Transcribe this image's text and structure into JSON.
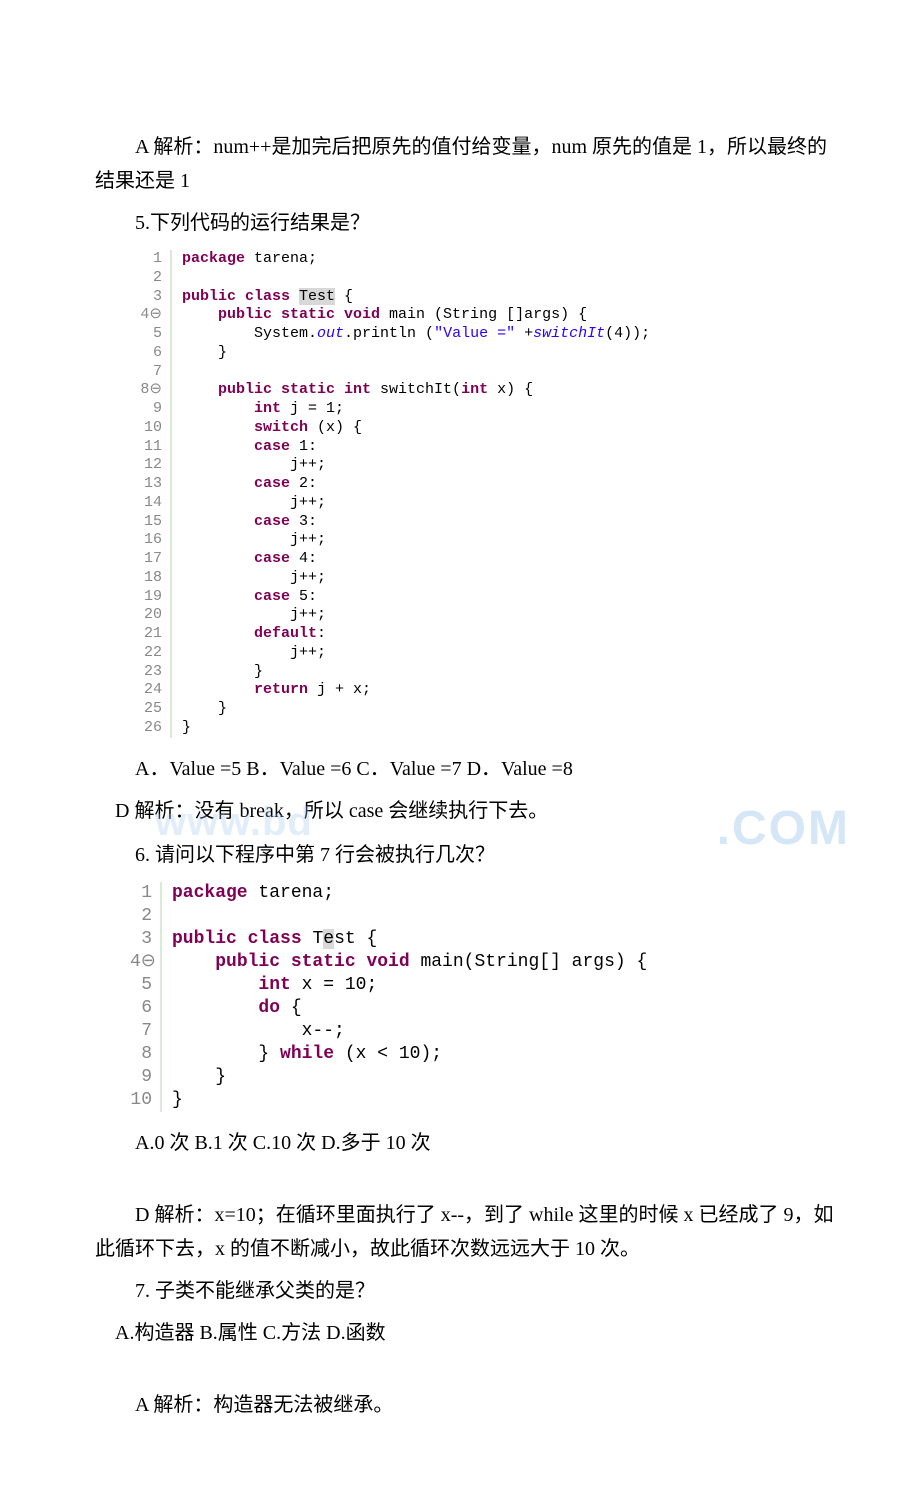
{
  "p1": "　　A 解析：num++是加完后把原先的值付给变量，num 原先的值是 1，所以最终的结果还是 1",
  "q5": "5.下列代码的运行结果是？",
  "code1": {
    "lines": [
      {
        "n": "1",
        "seg": [
          [
            "kw",
            "package"
          ],
          [
            "p",
            " tarena;"
          ]
        ]
      },
      {
        "n": "2",
        "seg": []
      },
      {
        "n": "3",
        "seg": [
          [
            "kw",
            "public class "
          ],
          [
            "hl",
            "Test"
          ],
          [
            "p",
            " {"
          ]
        ]
      },
      {
        "n": "4⊖",
        "seg": [
          [
            "p",
            "    "
          ],
          [
            "kw",
            "public static void"
          ],
          [
            "p",
            " main (String []args) {"
          ]
        ]
      },
      {
        "n": "5",
        "seg": [
          [
            "p",
            "        System."
          ],
          [
            "static",
            "out"
          ],
          [
            "p",
            ".println ("
          ],
          [
            "str",
            "\"Value =\""
          ],
          [
            "p",
            " +"
          ],
          [
            "static",
            "switchIt"
          ],
          [
            "p",
            "(4));"
          ]
        ]
      },
      {
        "n": "6",
        "seg": [
          [
            "p",
            "    }"
          ]
        ]
      },
      {
        "n": "7",
        "seg": []
      },
      {
        "n": "8⊖",
        "seg": [
          [
            "p",
            "    "
          ],
          [
            "kw",
            "public static int"
          ],
          [
            "p",
            " switchIt("
          ],
          [
            "kw",
            "int"
          ],
          [
            "p",
            " x) {"
          ]
        ]
      },
      {
        "n": "9",
        "seg": [
          [
            "p",
            "        "
          ],
          [
            "kw",
            "int"
          ],
          [
            "p",
            " j = 1;"
          ]
        ]
      },
      {
        "n": "10",
        "seg": [
          [
            "p",
            "        "
          ],
          [
            "kw",
            "switch"
          ],
          [
            "p",
            " (x) {"
          ]
        ]
      },
      {
        "n": "11",
        "seg": [
          [
            "p",
            "        "
          ],
          [
            "kw",
            "case"
          ],
          [
            "p",
            " 1:"
          ]
        ]
      },
      {
        "n": "12",
        "seg": [
          [
            "p",
            "            j++;"
          ]
        ]
      },
      {
        "n": "13",
        "seg": [
          [
            "p",
            "        "
          ],
          [
            "kw",
            "case"
          ],
          [
            "p",
            " 2:"
          ]
        ]
      },
      {
        "n": "14",
        "seg": [
          [
            "p",
            "            j++;"
          ]
        ]
      },
      {
        "n": "15",
        "seg": [
          [
            "p",
            "        "
          ],
          [
            "kw",
            "case"
          ],
          [
            "p",
            " 3:"
          ]
        ]
      },
      {
        "n": "16",
        "seg": [
          [
            "p",
            "            j++;"
          ]
        ]
      },
      {
        "n": "17",
        "seg": [
          [
            "p",
            "        "
          ],
          [
            "kw",
            "case"
          ],
          [
            "p",
            " 4:"
          ]
        ]
      },
      {
        "n": "18",
        "seg": [
          [
            "p",
            "            j++;"
          ]
        ]
      },
      {
        "n": "19",
        "seg": [
          [
            "p",
            "        "
          ],
          [
            "kw",
            "case"
          ],
          [
            "p",
            " 5:"
          ]
        ]
      },
      {
        "n": "20",
        "seg": [
          [
            "p",
            "            j++;"
          ]
        ]
      },
      {
        "n": "21",
        "seg": [
          [
            "p",
            "        "
          ],
          [
            "kw",
            "default"
          ],
          [
            "p",
            ":"
          ]
        ]
      },
      {
        "n": "22",
        "seg": [
          [
            "p",
            "            j++;"
          ]
        ]
      },
      {
        "n": "23",
        "seg": [
          [
            "p",
            "        }"
          ]
        ]
      },
      {
        "n": "24",
        "seg": [
          [
            "p",
            "        "
          ],
          [
            "kw",
            "return"
          ],
          [
            "p",
            " j + x;"
          ]
        ]
      },
      {
        "n": "25",
        "seg": [
          [
            "p",
            "    }"
          ]
        ]
      },
      {
        "n": "26",
        "seg": [
          [
            "p",
            "}"
          ]
        ]
      }
    ]
  },
  "q5opts": "A．Value =5 B．Value =6 C．Value =7 D．Value =8",
  "q5ans": " D 解析：没有 break，所以 case 会继续执行下去。",
  "wm_right": ".COM",
  "wm_left": "www.bd",
  "q6": "6. 请问以下程序中第 7 行会被执行几次？",
  "code2": {
    "lines": [
      {
        "n": "1",
        "seg": [
          [
            "kw",
            "package"
          ],
          [
            "p",
            " tarena;"
          ]
        ]
      },
      {
        "n": "2",
        "seg": []
      },
      {
        "n": "3",
        "seg": [
          [
            "kw",
            "public class "
          ],
          [
            "p",
            "T"
          ],
          [
            "hl",
            "e"
          ],
          [
            "p",
            "st {"
          ]
        ]
      },
      {
        "n": "4⊖",
        "seg": [
          [
            "p",
            "    "
          ],
          [
            "kw",
            "public static void"
          ],
          [
            "p",
            " main(String[] args) {"
          ]
        ]
      },
      {
        "n": "5",
        "seg": [
          [
            "p",
            "        "
          ],
          [
            "kw",
            "int"
          ],
          [
            "p",
            " x = 10;"
          ]
        ]
      },
      {
        "n": "6",
        "seg": [
          [
            "p",
            "        "
          ],
          [
            "kw",
            "do"
          ],
          [
            "p",
            " {"
          ]
        ]
      },
      {
        "n": "7",
        "seg": [
          [
            "p",
            "            x--;"
          ]
        ]
      },
      {
        "n": "8",
        "seg": [
          [
            "p",
            "        } "
          ],
          [
            "kw",
            "while"
          ],
          [
            "p",
            " (x < 10);"
          ]
        ]
      },
      {
        "n": "9",
        "seg": [
          [
            "p",
            "    }"
          ]
        ]
      },
      {
        "n": "10",
        "seg": [
          [
            "p",
            "}"
          ]
        ]
      }
    ]
  },
  "q6opts": "A.0 次 B.1 次 C.10 次  D.多于 10 次",
  "q6ans": "D 解析：x=10；在循环里面执行了 x--，到了 while 这里的时候 x 已经成了 9，如此循环下去，x 的值不断减小，故此循环次数远远大于 10 次。",
  "q7": "7. 子类不能继承父类的是？",
  "q7opts": " A.构造器  B.属性 C.方法 D.函数",
  "q7ans": "A 解析：构造器无法被继承。"
}
